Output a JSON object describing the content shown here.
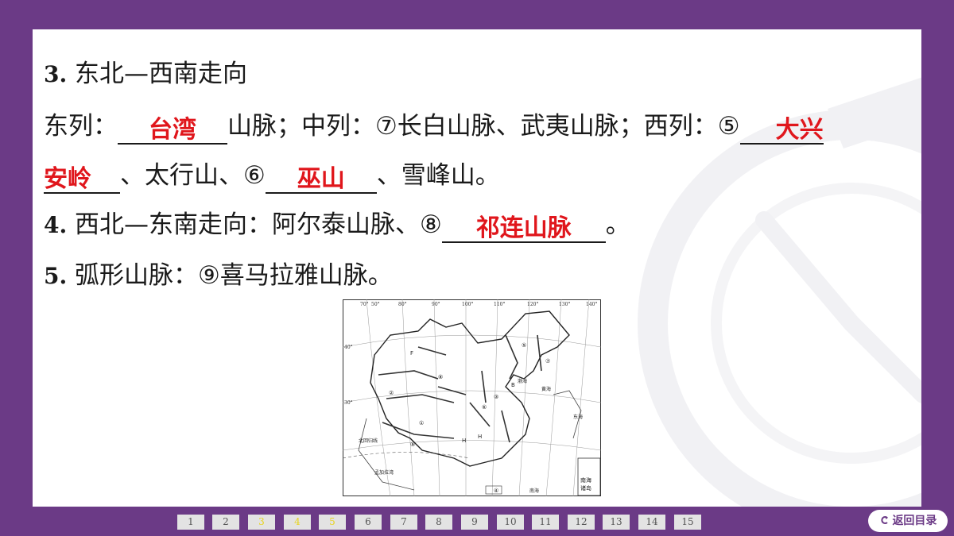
{
  "section3": {
    "num": "3",
    "heading": "东北—西南走向",
    "east_label": "东列：",
    "east_answer": "台湾",
    "east_suffix": "山脉；中列：⑦长白山脉、武夷山脉；西列：⑤",
    "west_answer_1": "大兴",
    "west_answer_2": "安岭",
    "middle_text": "、太行山、⑥",
    "six_answer": "巫山",
    "end_text": "、雪峰山。"
  },
  "section4": {
    "num": "4",
    "text": "西北—东南走向：阿尔泰山脉、⑧",
    "answer": "祁连山脉",
    "end": "。"
  },
  "section5": {
    "num": "5",
    "text": "弧形山脉：⑨喜马拉雅山脉。"
  },
  "map": {
    "top_labels": [
      "70°",
      "50°",
      "80°",
      "90°",
      "100°",
      "110°",
      "120°",
      "130°",
      "140°"
    ],
    "lat_labels": [
      "40°",
      "30°"
    ],
    "region_labels": [
      "南海诸岛",
      "孟加拉湾",
      "北回归线",
      "南海",
      "东海",
      "黄海",
      "渤海"
    ],
    "markers": [
      "①",
      "②",
      "③",
      "④",
      "⑤",
      "⑥",
      "⑦",
      "⑧",
      "⑨"
    ]
  },
  "pager": {
    "pages": [
      "1",
      "2",
      "3",
      "4",
      "5",
      "6",
      "7",
      "8",
      "9",
      "10",
      "11",
      "12",
      "13",
      "14",
      "15"
    ],
    "highlighted": [
      "3",
      "4",
      "5"
    ]
  },
  "back_button": {
    "label": "返回目录",
    "icon": "return-arrow-icon"
  },
  "colors": {
    "frame": "#6b3a86",
    "answer": "#e0161c"
  }
}
